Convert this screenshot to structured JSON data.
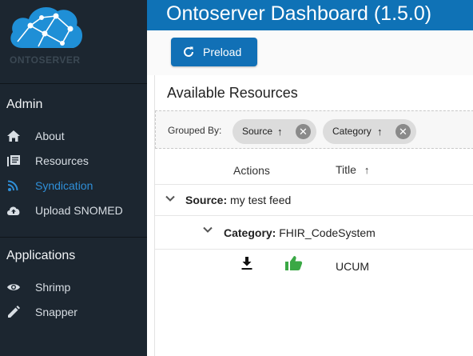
{
  "sidebar": {
    "logo_text": "ONTOSERVER",
    "sections": [
      {
        "title": "Admin",
        "items": [
          {
            "label": "About",
            "icon": "home-icon"
          },
          {
            "label": "Resources",
            "icon": "library-books-icon"
          },
          {
            "label": "Syndication",
            "icon": "rss-feed-icon",
            "active": true
          },
          {
            "label": "Upload SNOMED",
            "icon": "cloud-upload-icon"
          }
        ]
      },
      {
        "title": "Applications",
        "items": [
          {
            "label": "Shrimp",
            "icon": "eye-icon"
          },
          {
            "label": "Snapper",
            "icon": "pencil-icon"
          }
        ]
      }
    ]
  },
  "header": {
    "title": "Ontoserver Dashboard (1.5.0)"
  },
  "toolbar": {
    "preload_label": "Preload"
  },
  "panel": {
    "title": "Available Resources",
    "grouped_by_label": "Grouped By:",
    "chips": [
      {
        "label": "Source"
      },
      {
        "label": "Category"
      }
    ],
    "columns": {
      "actions": "Actions",
      "title": "Title"
    },
    "group_source": {
      "key": "Source:",
      "value": "my test feed"
    },
    "group_category": {
      "key": "Category:",
      "value": "FHIR_CodeSystem"
    },
    "row": {
      "title": "UCUM"
    }
  },
  "colors": {
    "sidebar_bg": "#1c2630",
    "header_bg": "#0f72b6",
    "accent": "#1170b6",
    "active_nav": "#2f8fd8",
    "thumb_green": "#3aa845"
  }
}
